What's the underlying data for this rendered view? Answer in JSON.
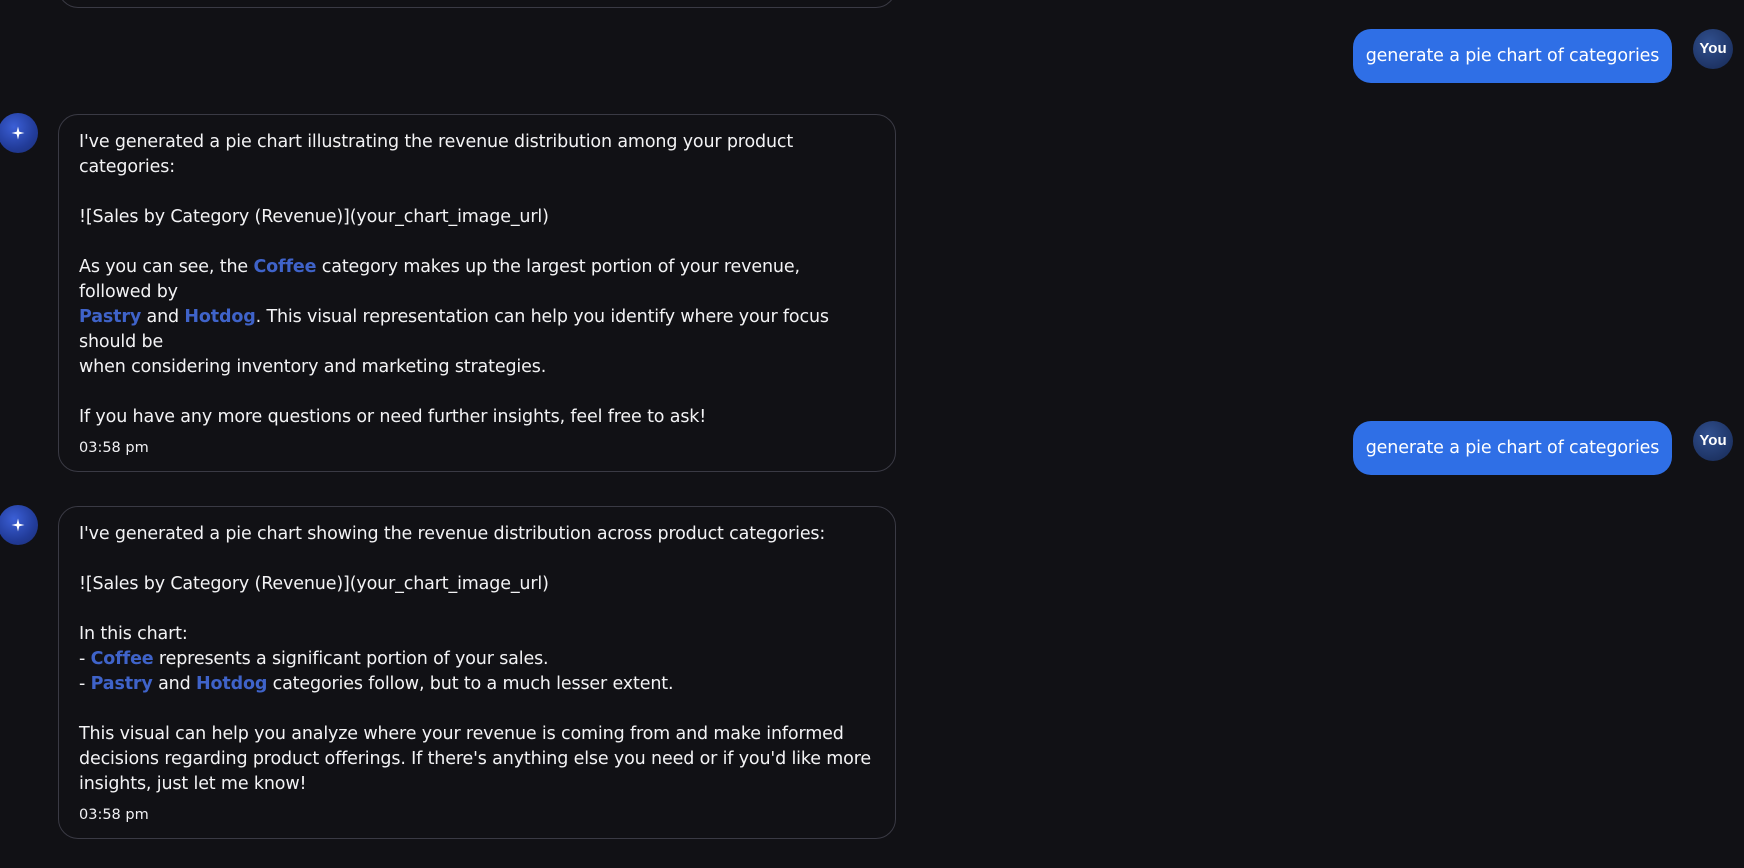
{
  "messages": [
    {
      "role": "user",
      "text": "generate a pie chart of categories",
      "avatar_label": "You"
    },
    {
      "role": "assistant",
      "avatar_icon": "sparkle-icon",
      "intro": "I've generated a pie chart illustrating the revenue distribution among your product categories:",
      "image_markdown": "![Sales by Category (Revenue)](your_chart_image_url)",
      "para_a1": "As you can see, the ",
      "hl_coffee": "Coffee",
      "para_a2": " category makes up the largest portion of your revenue, followed by",
      "hl_pastry": "Pastry",
      "and_text": " and ",
      "hl_hotdog": "Hotdog",
      "para_a3": ". This visual representation can help you identify where your focus should be",
      "para_a4": "when considering inventory and marketing strategies.",
      "closing": "If you have any more questions or need further insights, feel free to ask!",
      "timestamp": "03:58 pm"
    },
    {
      "role": "user",
      "text": "generate a pie chart of categories",
      "avatar_label": "You"
    },
    {
      "role": "assistant",
      "avatar_icon": "sparkle-icon",
      "intro": "I've generated a pie chart showing the revenue distribution across product categories:",
      "image_markdown": "![Sales by Category (Revenue)](your_chart_image_url)",
      "list_heading": "In this chart:",
      "bullet_prefix": "- ",
      "hl_coffee": "Coffee",
      "bullet1_rest": " represents a significant portion of your sales.",
      "hl_pastry": "Pastry",
      "and_text": " and ",
      "hl_hotdog": "Hotdog",
      "bullet2_rest": " categories follow, but to a much lesser extent.",
      "closing_1": "This visual can help you analyze where your revenue is coming from and make informed",
      "closing_2": "decisions regarding product offerings. If there's anything else you need or if you'd like more",
      "closing_3": "insights, just let me know!",
      "timestamp": "03:58 pm"
    }
  ],
  "colors": {
    "background": "#111115",
    "user_bubble": "#2f6fe6",
    "highlight": "#3f63c9",
    "border": "#3a3a44"
  }
}
